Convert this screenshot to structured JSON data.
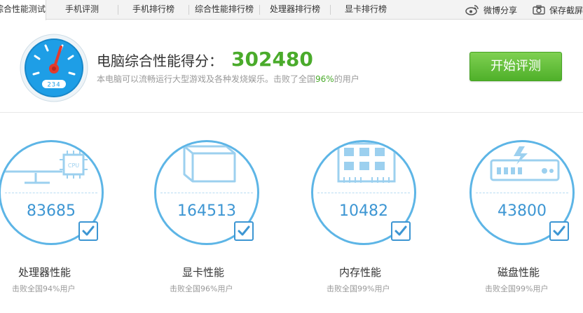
{
  "tabs": [
    {
      "label": "综合性能测试",
      "active": true
    },
    {
      "label": "手机评测",
      "active": false
    },
    {
      "label": "手机排行榜",
      "active": false
    },
    {
      "label": "综合性能排行榜",
      "active": false
    },
    {
      "label": "处理器排行榜",
      "active": false
    },
    {
      "label": "显卡排行榜",
      "active": false
    }
  ],
  "toolbar": {
    "weibo_share": "微博分享",
    "save_screenshot": "保存截屏"
  },
  "gauge": {
    "readout": "234"
  },
  "score": {
    "label": "电脑综合性能得分：",
    "value": "302480",
    "desc_prefix": "本电脑可以流畅运行大型游戏及各种发烧娱乐。击败了全国",
    "desc_pct": "96%",
    "desc_suffix": "的用户"
  },
  "start_button": "开始评测",
  "components": [
    {
      "name": "处理器性能",
      "score": "83685",
      "beat": "击败全国94%用户",
      "icon": "cpu-monitor-icon",
      "chip_label": "CPU"
    },
    {
      "name": "显卡性能",
      "score": "164513",
      "beat": "击败全国96%用户",
      "icon": "graphics-cube-icon"
    },
    {
      "name": "内存性能",
      "score": "10482",
      "beat": "击败全国99%用户",
      "icon": "memory-chip-icon"
    },
    {
      "name": "磁盘性能",
      "score": "43800",
      "beat": "击败全国99%用户",
      "icon": "hard-disk-icon"
    }
  ],
  "colors": {
    "accent_blue": "#3d96d3",
    "score_green": "#4aab2b",
    "button_green": "#5cbc33",
    "gauge_blue": "#1e9ee6",
    "gauge_needle": "#e23b2e"
  }
}
